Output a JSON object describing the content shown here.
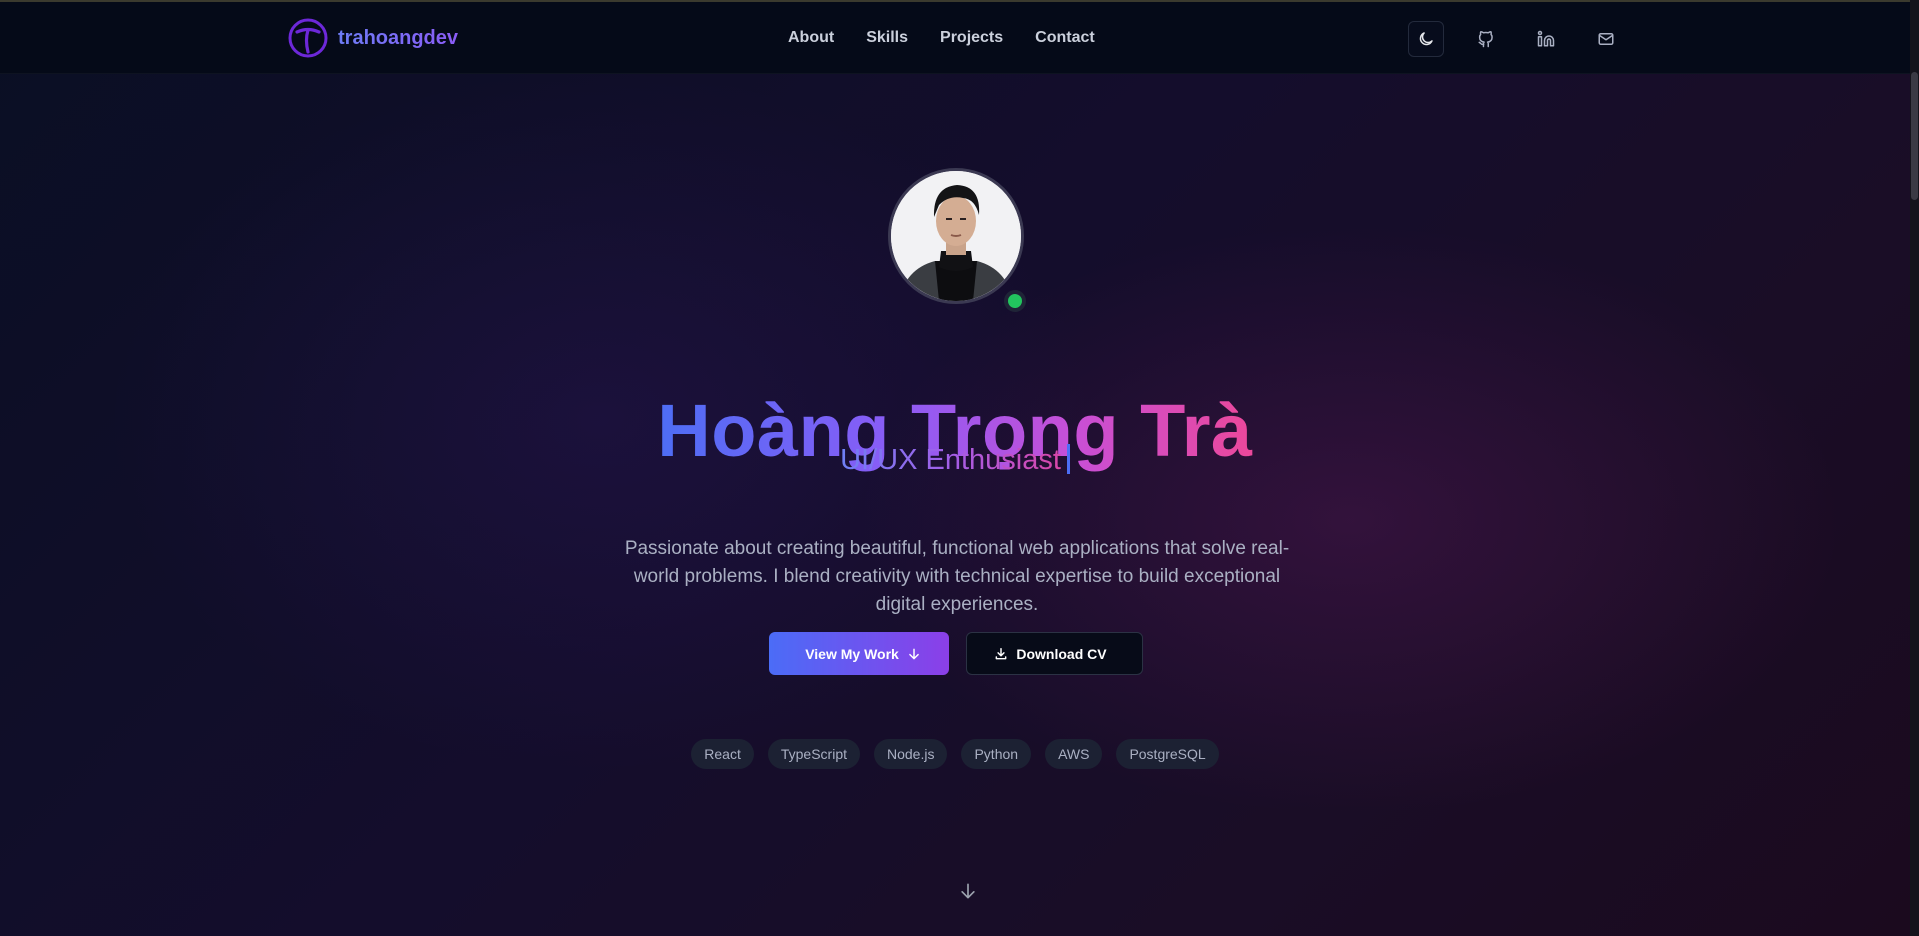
{
  "brand": {
    "name": "trahoangdev",
    "logo_icon": "t-logo-icon",
    "accent": "#6d28d9"
  },
  "nav": {
    "links": [
      "About",
      "Skills",
      "Projects",
      "Contact"
    ]
  },
  "header_actions": [
    "moon-icon",
    "github-icon",
    "linkedin-icon",
    "mail-icon"
  ],
  "hero": {
    "name": "Hoàng Trọng Trà",
    "role": "UI/UX Enthusiast",
    "description": "Passionate about creating beautiful, functional web applications that solve real-world problems. I blend creativity with technical expertise to build exceptional digital experiences.",
    "status": "online",
    "status_color": "#22c55e",
    "primary_button": "View My Work",
    "secondary_button": "Download CV",
    "tags": [
      "React",
      "TypeScript",
      "Node.js",
      "Python",
      "AWS",
      "PostgreSQL"
    ]
  },
  "colors": {
    "gradient_start": "#4c6ef5",
    "gradient_mid": "#8b5cf6",
    "gradient_end": "#ec4899",
    "background": "#0b0a1c"
  }
}
